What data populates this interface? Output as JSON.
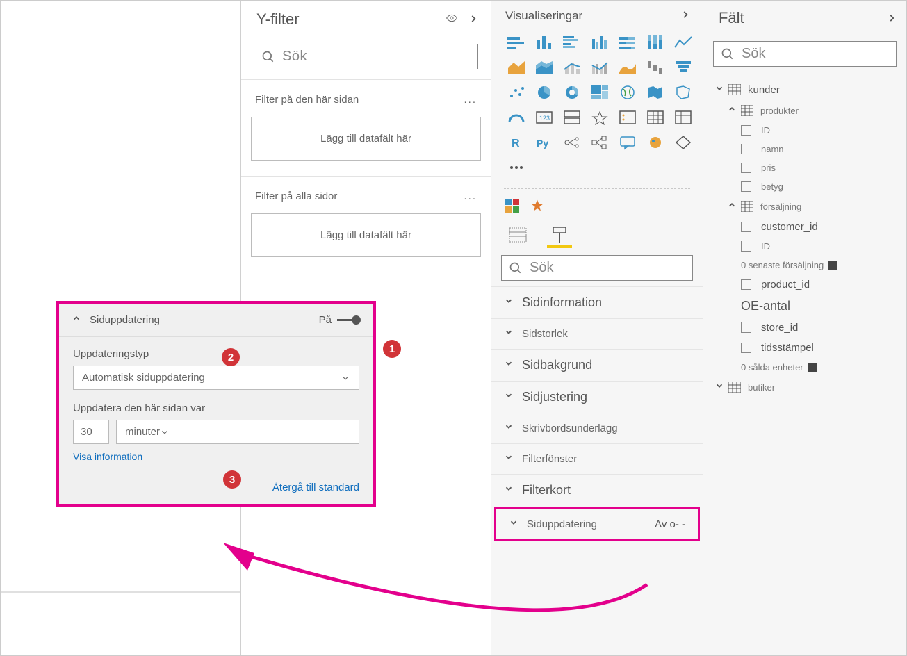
{
  "filters_pane": {
    "title": "Y-filter",
    "search_placeholder": "Sök",
    "section_page": {
      "label": "Filter på den här sidan",
      "drop_hint": "Lägg till datafält här"
    },
    "section_all": {
      "label": "Filter på alla sidor",
      "drop_hint": "Lägg till datafält här"
    }
  },
  "viz_pane": {
    "title": "Visualiseringar",
    "search_placeholder": "Sök",
    "format_groups": {
      "page_info": "Sidinformation",
      "page_size": "Sidstorlek",
      "page_bg": "Sidbakgrund",
      "page_align": "Sidjustering",
      "wallpaper": "Skrivbordsunderlägg",
      "filter_pane": "Filterfönster",
      "filter_cards": "Filterkort",
      "page_refresh": "Siduppdatering",
      "page_refresh_state": "Av o-  -"
    }
  },
  "fields_pane": {
    "title": "Fält",
    "search_placeholder": "Sök",
    "tables": {
      "kunder": "kunder",
      "produkter": "produkter",
      "forsaljning": "försäljning",
      "butiker": "butiker"
    },
    "produkter_fields": {
      "id": "ID",
      "namn": "namn",
      "pris": "pris",
      "betyg": "betyg"
    },
    "forsaljning_fields": {
      "customer_id": "customer_id",
      "id": "ID",
      "senaste": "0 senaste försäljning",
      "product_id": "product_id",
      "oe_antal": "OE-antal",
      "store_id": "store_id",
      "tidsstampel": "tidsstämpel",
      "salda": "0 sålda enheter"
    }
  },
  "callout": {
    "header": "Siduppdatering",
    "on_label": "På",
    "type_label": "Uppdateringstyp",
    "type_value": "Automatisk siduppdatering",
    "interval_label": "Uppdatera den här sidan var",
    "interval_value": "30",
    "interval_unit": "minuter",
    "details_link": "Visa information",
    "reset_link": "Återgå till standard"
  },
  "badges": {
    "b1": "1",
    "b2": "2",
    "b3": "3"
  }
}
